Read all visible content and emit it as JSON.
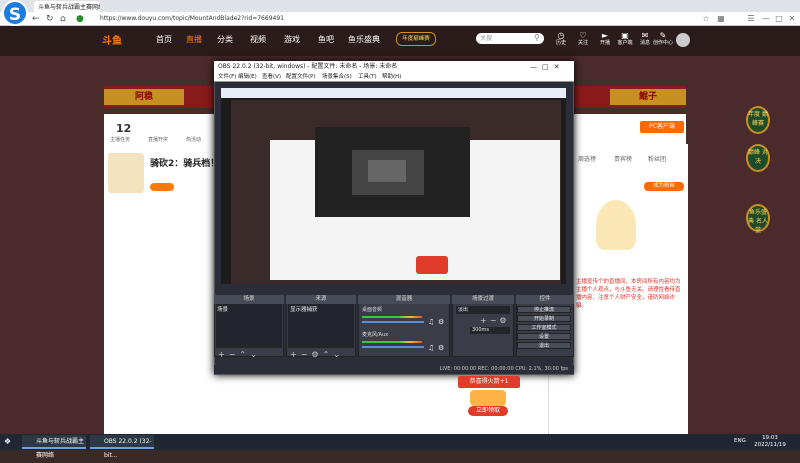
{
  "browser": {
    "tab1": "斗鱼与斩兵战霸主赛网络",
    "tab2": "斗鱼与斩兵战霸主赛网络",
    "url": "https://www.douyu.com/topic/MountAndBlade2?rid=7669491"
  },
  "site": {
    "logo": "斗鱼",
    "nav": [
      "首页",
      "直播",
      "分类",
      "视频",
      "游戏",
      "鱼吧",
      "鱼乐盛典"
    ],
    "promo": "年度巅峰赛",
    "search_placeholder": "关搜",
    "icons": [
      "历史",
      "关注",
      "开播",
      "客户端",
      "消息",
      "创作中心"
    ]
  },
  "banner": {
    "left": "阿稳",
    "right": "鲲子"
  },
  "room": {
    "count": "12",
    "title": "骑砍2：骑兵档！",
    "follow": "PC客户端",
    "stats": [
      "主播任务",
      "直播开奖",
      "热活动"
    ]
  },
  "side_badges": [
    "年度\n巅峰赛",
    "巅峰\n对决",
    "鱼乐盛典\n名人堂"
  ],
  "chat": {
    "tabs": [
      "周选榜",
      "贵宾榜",
      "粉丝团"
    ],
    "status": "成为粉丝",
    "text": "主播宣传个的直播间，本房间所有内容均为主播个人观点，与斗鱼无关。请理性看待直播内容，注意个人财产安全，谨防网络诈骗。"
  },
  "obs": {
    "title": "OBS 22.0.2 (32-bit, windows) - 配置文件: 未命名 - 场景: 未命名",
    "menu": [
      "文件(F)",
      "编辑(E)",
      "查看(V)",
      "配置文件(P)",
      "场景集合(S)",
      "工具(T)",
      "帮助(H)"
    ],
    "docks": [
      "场景",
      "来源",
      "混音器",
      "场景过渡",
      "控件"
    ],
    "scene_item": "场景",
    "source_item": "显示器捕获",
    "mixer": [
      "桌面音频",
      "麦克风/Aux"
    ],
    "transition": "淡出",
    "duration": "300ms",
    "controls": [
      "停止推流",
      "开始录制",
      "工作室模式",
      "设置",
      "退出"
    ],
    "status": "LIVE: 00:00:00   REC: 00:00:00   CPU: 2.1%, 30.00 fps"
  },
  "reward": {
    "banner": "恭喜得火箭+1",
    "button": "立即领取"
  },
  "ad_label": "广告",
  "taskbar": {
    "app1": "斗鱼与斩兵战霸主赛网络",
    "app2": "OBS 22.0.2 (32-bit...",
    "lang": "ENG",
    "time": "19:03",
    "date": "2022/11/19"
  }
}
